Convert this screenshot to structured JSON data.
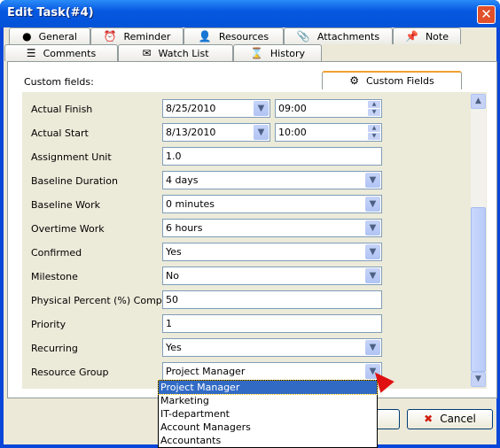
{
  "window": {
    "title": "Edit Task(#4)",
    "close_icon": "close-icon"
  },
  "tabs_row1": [
    {
      "label": "General",
      "icon": "sphere-icon"
    },
    {
      "label": "Reminder",
      "icon": "alarm-clock-icon"
    },
    {
      "label": "Resources",
      "icon": "user-icon"
    },
    {
      "label": "Attachments",
      "icon": "paperclip-icon"
    },
    {
      "label": "Note",
      "icon": "pin-icon"
    }
  ],
  "tabs_row2": [
    {
      "label": "Comments",
      "icon": "comments-icon"
    },
    {
      "label": "Watch List",
      "icon": "watch-list-icon"
    },
    {
      "label": "History",
      "icon": "hourglass-icon"
    },
    {
      "label": "Custom Fields",
      "icon": "gear-icon",
      "active": true
    }
  ],
  "custom_fields_label": "Custom fields:",
  "fields": [
    {
      "label": "Actual Finish",
      "date": "8/25/2010",
      "time": "09:00"
    },
    {
      "label": "Actual Start",
      "date": "8/13/2010",
      "time": "10:00"
    },
    {
      "label": "Assignment Unit",
      "value": "1.0"
    },
    {
      "label": "Baseline Duration",
      "value": "4 days"
    },
    {
      "label": "Baseline Work",
      "value": "0 minutes"
    },
    {
      "label": "Overtime Work",
      "value": "6 hours"
    },
    {
      "label": "Confirmed",
      "value": "Yes"
    },
    {
      "label": "Milestone",
      "value": "No"
    },
    {
      "label": "Physical Percent (%) Complete",
      "value": "50"
    },
    {
      "label": "Priority",
      "value": "1"
    },
    {
      "label": "Recurring",
      "value": "Yes"
    },
    {
      "label": "Resource Group",
      "value": "Project Manager"
    }
  ],
  "dropdown_options": [
    "Project Manager",
    "Marketing",
    "IT-department",
    "Account Managers",
    "Accountants"
  ],
  "buttons": {
    "cancel": "Cancel"
  },
  "colors": {
    "selection": "#316ac5",
    "titlebar": "#0353d8",
    "panel": "#ecead9"
  }
}
